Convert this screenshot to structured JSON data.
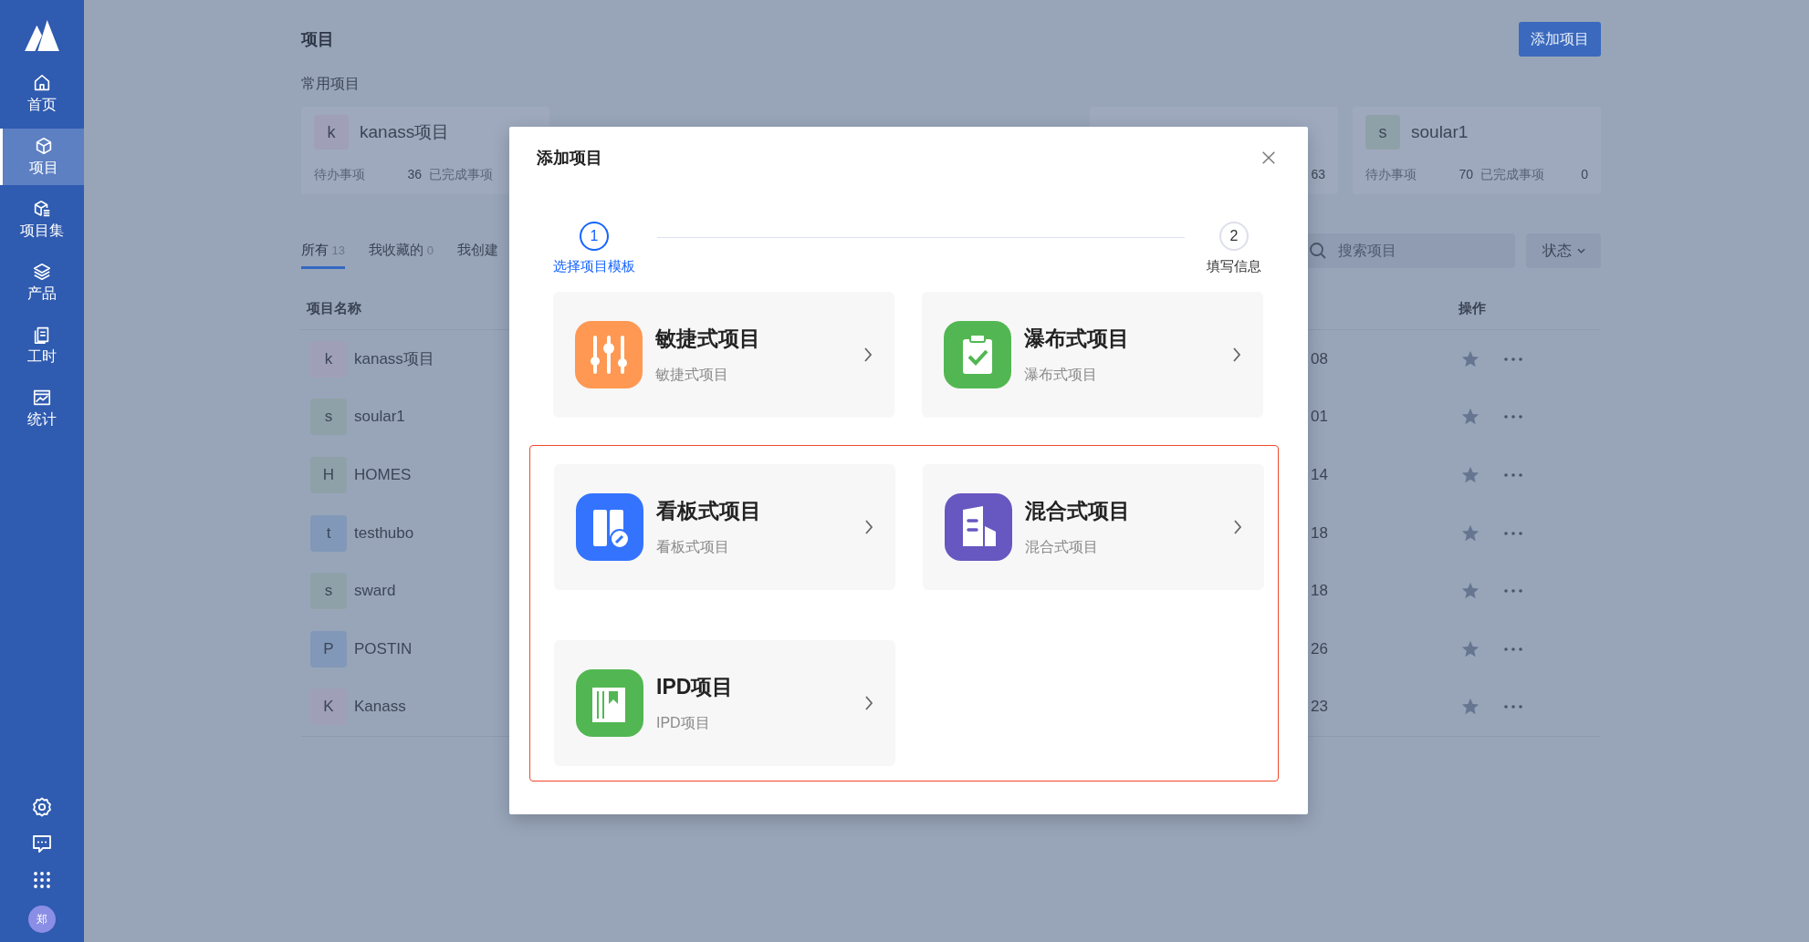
{
  "sidebar": {
    "items": [
      {
        "label": "首页",
        "selected": false
      },
      {
        "label": "项目",
        "selected": true
      },
      {
        "label": "项目集",
        "selected": false
      },
      {
        "label": "产品",
        "selected": false
      },
      {
        "label": "工时",
        "selected": false
      },
      {
        "label": "统计",
        "selected": false
      }
    ],
    "avatar": {
      "text": "郑"
    }
  },
  "page": {
    "title": "项目",
    "add_button": "添加项目",
    "recent_title": "常用项目",
    "recent_projects": [
      {
        "avatar": "k",
        "name": "kanass项目",
        "color": "#a09fb8",
        "todo_label": "待办事项",
        "todo_count": "36",
        "done_label": "已完成事项"
      },
      {
        "done_count": "63"
      },
      {
        "avatar": "s",
        "name": "soular1",
        "color": "#8fa1a8",
        "todo_label": "待办事项",
        "todo_count": "70",
        "done_label": "已完成事项",
        "done_count": "0"
      }
    ],
    "tabs": [
      {
        "label": "所有",
        "count": "13",
        "selected": true
      },
      {
        "label": "我收藏的",
        "count": "0",
        "selected": false
      },
      {
        "label": "我创建",
        "selected": false
      }
    ],
    "search": {
      "placeholder": "搜索项目"
    },
    "status_filter": "状态",
    "table": {
      "columns": {
        "name": "项目名称",
        "actions": "操作"
      },
      "rows": [
        {
          "avatar": "k",
          "name": "kanass项目",
          "color": "#a09fb8",
          "column_3": "08"
        },
        {
          "avatar": "s",
          "name": "soular1",
          "color": "#8fa1a8",
          "column_3": "01"
        },
        {
          "avatar": "H",
          "name": "HOMES",
          "color": "#8fa1a8",
          "column_3": "14"
        },
        {
          "avatar": "t",
          "name": "testhubo",
          "color": "#8198b8",
          "column_3": "18"
        },
        {
          "avatar": "s",
          "name": "sward",
          "color": "#8fa1a8",
          "column_3": "18"
        },
        {
          "avatar": "P",
          "name": "POSTIN",
          "color": "#8198b8",
          "column_3": "26"
        },
        {
          "avatar": "K",
          "name": "Kanass",
          "color": "#a09fb8",
          "column_3": "23"
        }
      ]
    }
  },
  "dialog": {
    "title": "添加项目",
    "steps": [
      {
        "number": "1",
        "label": "选择项目模板",
        "selected": true
      },
      {
        "number": "2",
        "label": "填写信息",
        "selected": false
      }
    ],
    "template_groups": [
      {
        "templates": [
          {
            "title": "敏捷式项目",
            "description": "敏捷式项目",
            "color": "#ff9852"
          },
          {
            "title": "瀑布式项目",
            "description": "瀑布式项目",
            "color": "#52b752"
          }
        ]
      },
      {
        "highlighted": true,
        "templates": [
          {
            "title": "看板式项目",
            "description": "看板式项目",
            "color": "#3373fe"
          },
          {
            "title": "混合式项目",
            "description": "混合式项目",
            "color": "#6657c1"
          },
          {
            "title": "IPD项目",
            "description": "IPD项目",
            "color": "#52b752"
          }
        ]
      }
    ]
  }
}
